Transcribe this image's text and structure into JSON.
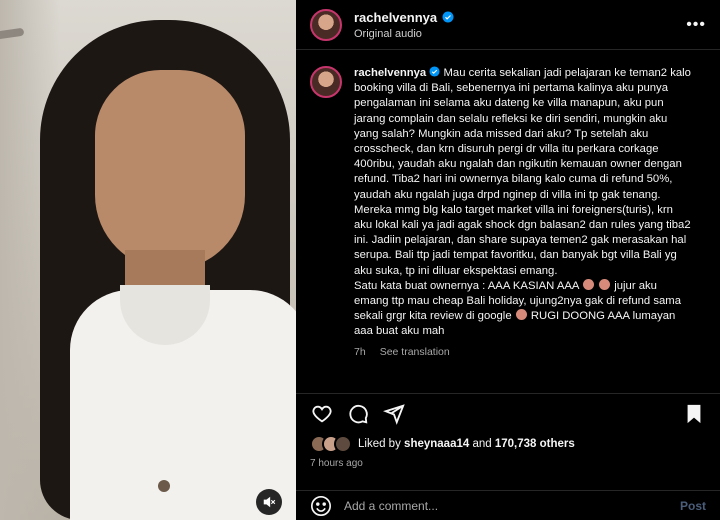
{
  "header": {
    "username": "rachelvennya",
    "subtitle": "Original audio"
  },
  "caption": {
    "username": "rachelvennya",
    "text": "Mau cerita sekalian jadi pelajaran ke teman2 kalo booking villa di Bali, sebenernya ini pertama kalinya aku punya pengalaman ini selama aku dateng ke villa manapun, aku pun jarang complain dan selalu refleksi ke diri sendiri, mungkin aku yang salah? Mungkin ada missed dari aku? Tp setelah aku crosscheck, dan krn disuruh pergi dr villa itu perkara corkage 400ribu, yaudah aku ngalah dan ngikutin kemauan owner dengan refund. Tiba2 hari ini ownernya bilang kalo cuma di refund 50%, yaudah aku ngalah juga drpd nginep di villa ini tp gak tenang. Mereka mmg blg kalo target market villa ini foreigners(turis), krn aku lokal kali ya jadi agak shock dgn balasan2 dan rules yang tiba2 ini. Jadiin pelajaran, dan share supaya temen2 gak merasakan hal serupa. Bali ttp jadi tempat favoritku, dan banyak bgt villa Bali yg aku suka, tp ini diluar ekspektasi emang.",
    "line2_a": "Satu kata buat ownernya : AAA KASIAN AAA",
    "line2_b": "jujur aku emang ttp mau cheap Bali holiday, ujung2nya gak di refund sama sekali grgr kita review di google",
    "line2_c": "RUGI DOONG AAA lumayan aaa buat aku mah",
    "time_ago": "7h",
    "see_translation": "See translation"
  },
  "likes": {
    "prefix": "Liked by",
    "first_user": "sheynaaa14",
    "middle": "and",
    "count": "170,738 others"
  },
  "posted": "7 hours ago",
  "comment_box": {
    "placeholder": "Add a comment...",
    "post_label": "Post"
  },
  "icons": {
    "more": "more-options-icon",
    "heart": "heart-icon",
    "comment": "comment-icon",
    "share": "share-icon",
    "save": "bookmark-icon",
    "emoji": "emoji-icon",
    "mute": "speaker-muted-icon",
    "verified": "verified-badge-icon"
  },
  "colors": {
    "verified": "#0095f6",
    "muted_text": "#a8a8a8",
    "post_disabled": "#4a5d7a"
  }
}
